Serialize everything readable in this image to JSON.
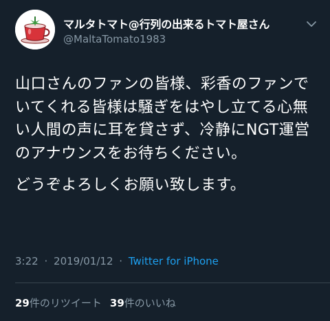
{
  "tweet": {
    "author": {
      "display_name": "マルタトマト@行列の出来るトマト屋さん",
      "handle": "@MaltaTomato1983",
      "avatar_icon": "tomato-cafe-avatar-icon"
    },
    "menu_icon": "chevron-down-icon",
    "text": {
      "paragraph1": "山口さんのファンの皆様、彩香のファンでいてくれる皆様は騒ぎをはやし立てる心無い人間の声に耳を貸さず、冷静にNGT運営のアナウンスをお待ちください。",
      "paragraph2": "どうぞよろしくお願い致します。"
    },
    "meta": {
      "time": "3:22",
      "separator": "·",
      "date": "2019/01/12",
      "source": "Twitter for iPhone"
    },
    "stats": {
      "retweets_count": "29",
      "retweets_label": "件のリツイート",
      "likes_count": "39",
      "likes_label": "件のいいね"
    }
  },
  "colors": {
    "background": "#15202b",
    "text_primary": "#ffffff",
    "text_secondary": "#8899a6",
    "link": "#1da1f2",
    "divider": "#38444d"
  }
}
